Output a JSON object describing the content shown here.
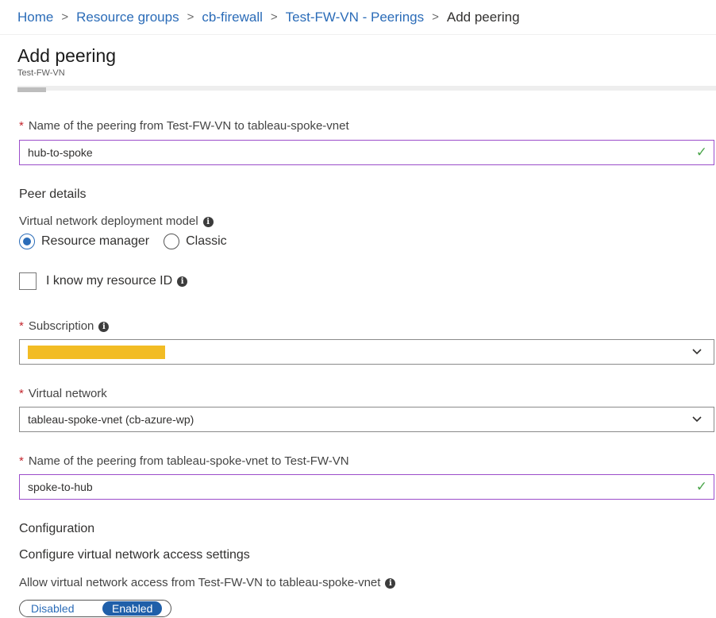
{
  "breadcrumb": {
    "items": [
      "Home",
      "Resource groups",
      "cb-firewall",
      "Test-FW-VN - Peerings"
    ],
    "current": "Add peering",
    "separator": ">"
  },
  "header": {
    "title": "Add peering",
    "subtitle": "Test-FW-VN"
  },
  "peering_name": {
    "label": "Name of the peering from Test-FW-VN to tableau-spoke-vnet",
    "value": "hub-to-spoke",
    "required_mark": "*"
  },
  "peer_details": {
    "heading": "Peer details",
    "deployment_model_label": "Virtual network deployment model",
    "options": [
      "Resource manager",
      "Classic"
    ],
    "selected": "Resource manager",
    "resource_id_label": "I know my resource ID",
    "resource_id_checked": false
  },
  "subscription": {
    "label": "Subscription",
    "value_redacted": true
  },
  "virtual_network": {
    "label": "Virtual network",
    "value": "tableau-spoke-vnet (cb-azure-wp)"
  },
  "remote_peering_name": {
    "label": "Name of the peering from tableau-spoke-vnet to Test-FW-VN",
    "value": "spoke-to-hub"
  },
  "configuration": {
    "heading": "Configuration",
    "subheading": "Configure virtual network access settings",
    "access_label": "Allow virtual network access from Test-FW-VN to tableau-spoke-vnet",
    "toggle_off": "Disabled",
    "toggle_on": "Enabled",
    "toggle_state": "Enabled"
  },
  "icons": {
    "info": "i",
    "check": "✓",
    "chevron": "⌵"
  },
  "colors": {
    "link": "#2b6cb8",
    "required": "#c4262e",
    "valid_border": "#9b4dca",
    "valid_check": "#4ca64c",
    "redaction": "#f2bc24",
    "toggle_active": "#1f5fa9"
  }
}
